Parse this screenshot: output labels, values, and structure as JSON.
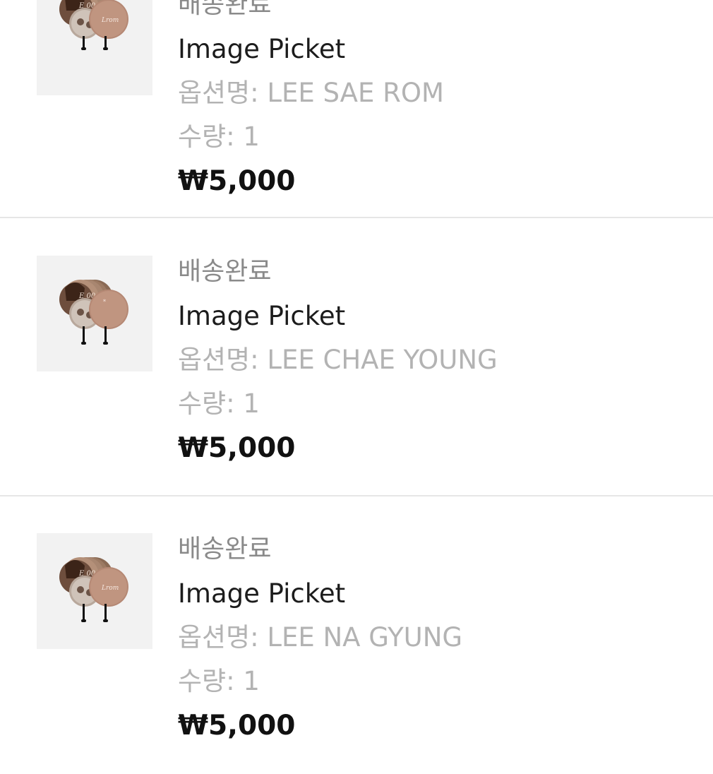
{
  "orders": [
    {
      "status": "배송완료",
      "product_name": "Image Picket",
      "option_label": "옵션명: ",
      "option_value": "LEE SAE ROM",
      "quantity_label": "수량: ",
      "quantity_value": "1",
      "price": "₩5,000",
      "thumbnail_icon": "picket-fan-product-image"
    },
    {
      "status": "배송완료",
      "product_name": "Image Picket",
      "option_label": "옵션명: ",
      "option_value": "LEE CHAE YOUNG",
      "quantity_label": "수량: ",
      "quantity_value": "1",
      "price": "₩5,000",
      "thumbnail_icon": "picket-fan-product-image"
    },
    {
      "status": "배송완료",
      "product_name": "Image Picket",
      "option_label": "옵션명: ",
      "option_value": "LEE NA GYUNG",
      "quantity_label": "수량: ",
      "quantity_value": "1",
      "price": "₩5,000",
      "thumbnail_icon": "picket-fan-product-image"
    }
  ]
}
